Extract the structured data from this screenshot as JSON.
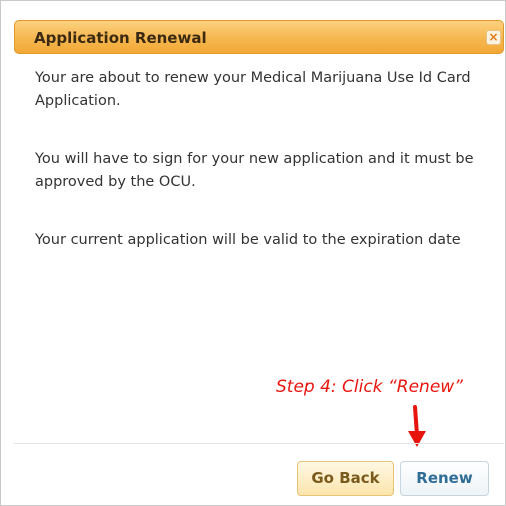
{
  "dialog": {
    "title": "Application Renewal",
    "close_label": "×",
    "paragraphs": [
      "Your are about to renew your Medical Marijuana Use Id Card Application.",
      "You will have to sign for your new application and it must be approved by the OCU.",
      "Your current application will be valid to the expiration date"
    ],
    "annotation": "Step 4: Click “Renew”",
    "buttons": {
      "go_back": "Go Back",
      "renew": "Renew"
    }
  },
  "colors": {
    "titlebar": "#f6b750",
    "annotation": "#e8150e",
    "renew_text": "#2f6d96",
    "go_back_text": "#7a5a1c"
  }
}
